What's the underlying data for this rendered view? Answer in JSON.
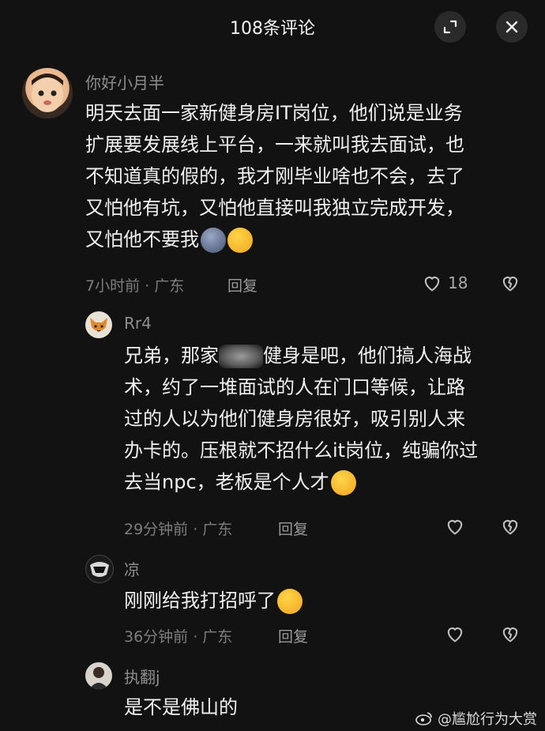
{
  "header": {
    "title": "108条评论"
  },
  "comments": [
    {
      "username": "你好小月半",
      "lines": [
        "明天去面一家新健身房IT岗位，他们说是业务",
        "扩展要发展线上平台，一来就叫我去面试，也",
        "不知道真的假的，我才刚毕业啥也不会，去了",
        "又怕他有坑，又怕他直接叫我独立完成开发，",
        "又怕他不要我"
      ],
      "meta": "7小时前 · 广东",
      "reply": "回复",
      "likes": "18"
    },
    {
      "username": "Rr4",
      "line1a": "兄弟，那家",
      "line1b": "健身是吧，他们搞人海战",
      "lines": [
        "术，约了一堆面试的人在门口等候，让路",
        "过的人以为他们健身房很好，吸引别人来",
        "办卡的。压根就不招什么it岗位，纯骗你过",
        "去当npc，老板是个人才"
      ],
      "meta": "29分钟前 · 广东",
      "reply": "回复"
    },
    {
      "username": "凉",
      "lines": [
        "刚刚给我打招呼了"
      ],
      "meta": "36分钟前 · 广东",
      "reply": "回复"
    },
    {
      "username": "执翻j",
      "lines": [
        "是不是佛山的"
      ]
    }
  ],
  "watermark": "@尴尬行为大赏"
}
